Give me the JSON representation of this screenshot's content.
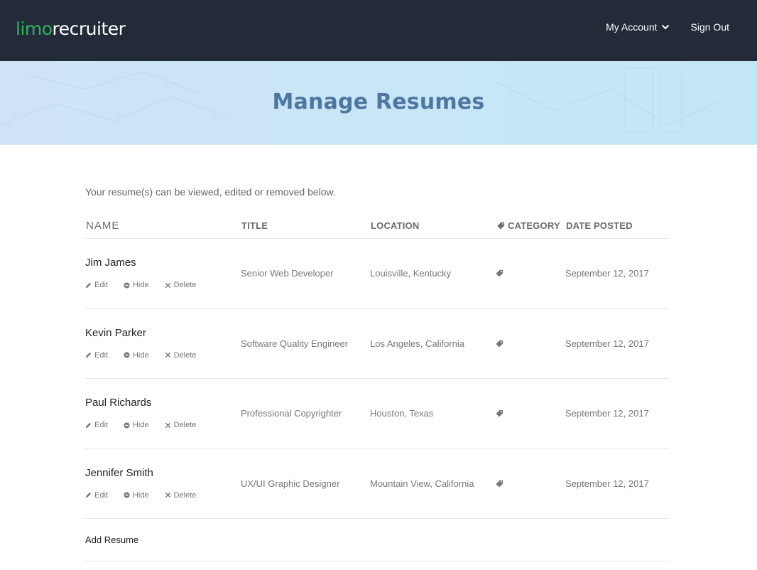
{
  "brand": {
    "part1": "limo",
    "part2": "recruiter"
  },
  "nav": {
    "account_label": "My Account",
    "signout_label": "Sign Out"
  },
  "page": {
    "title": "Manage Resumes",
    "intro": "Your resume(s) can be viewed, edited or removed below."
  },
  "table": {
    "headers": {
      "name": "NAME",
      "title": "TITLE",
      "location": "LOCATION",
      "category": "CATEGORY",
      "date": "DATE POSTED"
    },
    "actions": {
      "edit": "Edit",
      "hide": "Hide",
      "delete": "Delete"
    },
    "rows": [
      {
        "name": "Jim James",
        "title": "Senior Web Developer",
        "location": "Louisville, Kentucky",
        "date": "September 12, 2017"
      },
      {
        "name": "Kevin Parker",
        "title": "Software Quality Engineer",
        "location": "Los Angeles, California",
        "date": "September 12, 2017"
      },
      {
        "name": "Paul Richards",
        "title": "Professional Copyrighter",
        "location": "Houston, Texas",
        "date": "September 12, 2017"
      },
      {
        "name": "Jennifer Smith",
        "title": "UX/UI Graphic Designer",
        "location": "Mountain View, California",
        "date": "September 12, 2017"
      }
    ]
  },
  "add_resume_label": "Add Resume",
  "colors": {
    "topbar": "#232b39",
    "brand_green": "#2fb35f",
    "title_blue": "#4d76a0"
  }
}
